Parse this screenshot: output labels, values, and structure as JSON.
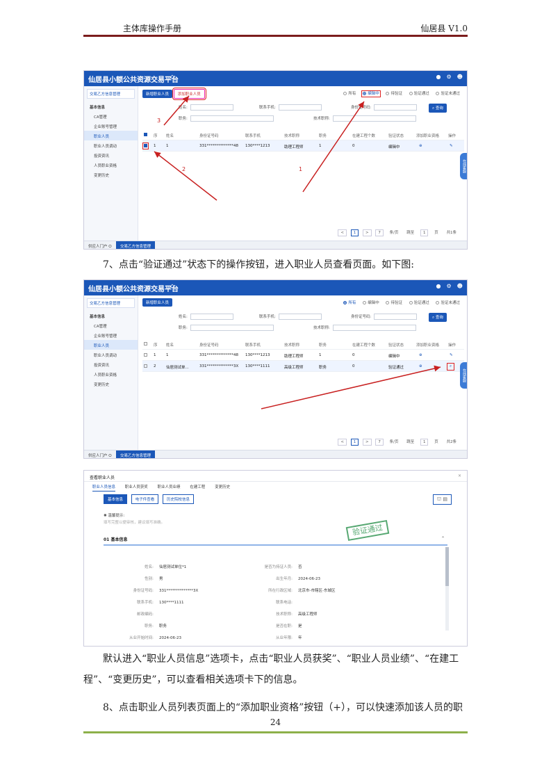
{
  "header": {
    "left": "主体库操作手册",
    "right": "仙居县   V1.0"
  },
  "app": {
    "title": "仙居县小额公共资源交易平台",
    "home_icon": "home-icon"
  },
  "shot1": {
    "sidebar_group": "交易乙方信息管理",
    "sidebar_items": [
      "基本信息",
      "CA管理",
      "企业账号管理",
      "职业人员",
      "职业人员调动",
      "投资资讯",
      "人员职业资格",
      "变更历史"
    ],
    "add_button": "新增职业人员",
    "add_qual_button": "添加职业人员",
    "radios": [
      "所有",
      "编辑中",
      "待验证",
      "验证通过",
      "验证未通过"
    ],
    "fields": {
      "name": "姓名:",
      "phone": "联系手机:",
      "id": "身份证号码:",
      "title": "职务:",
      "skill": "技术职称:"
    },
    "search": "查询",
    "columns": [
      "序",
      "姓名",
      "身份证号码",
      "联系手机",
      "技术职称",
      "职务",
      "在建工程个数",
      "验证状态",
      "添加职业资格",
      "操作"
    ],
    "row": [
      "1",
      "1",
      "331**************48",
      "130****1213",
      "助理工程师",
      "1",
      "0",
      "编辑中"
    ],
    "annot": [
      "1",
      "2",
      "3"
    ],
    "pager": {
      "page": "1",
      "next": ">",
      "prev": "<",
      "size": "7",
      "per": "条/页",
      "go": "跳至",
      "p": "页",
      "total": "共1条",
      "num": "1"
    },
    "bottom": [
      "供应人门户 ⭘",
      "交易乙方信息管理"
    ],
    "sidetab": "在线客服"
  },
  "p7": "7、点击“验证通过”状态下的操作按钮，进入职业人员查看页面。如下图:",
  "shot2": {
    "sidebar_group": "交易乙方信息管理",
    "sidebar_items": [
      "基本信息",
      "CA管理",
      "企业账号管理",
      "职业人员",
      "职业人员调动",
      "投资资讯",
      "人员职业资格",
      "变更历史"
    ],
    "add_button": "新增职业人员",
    "radios": [
      "所有",
      "编辑中",
      "待验证",
      "验证通过",
      "验证未通过"
    ],
    "fields": {
      "name": "姓名:",
      "phone": "联系手机:",
      "id": "身份证号码:",
      "title": "职务:",
      "skill": "技术职称:"
    },
    "search": "查询",
    "columns": [
      "序",
      "姓名",
      "身份证号码",
      "联系手机",
      "技术职称",
      "职务",
      "在建工程个数",
      "验证状态",
      "添加职业资格",
      "操作"
    ],
    "rows": [
      [
        "1",
        "1",
        "331**************48",
        "130****1213",
        "助理工程师",
        "1",
        "0",
        "编辑中"
      ],
      [
        "2",
        "仙居测试单...",
        "331**************3X",
        "130****1111",
        "高级工程师",
        "职务",
        "0",
        "验证通过"
      ]
    ],
    "pager": {
      "page": "1",
      "next": ">",
      "prev": "<",
      "size": "7",
      "per": "条/页",
      "go": "跳至",
      "p": "页",
      "total": "共2条",
      "num": "1"
    },
    "bottom": [
      "供应人门户 ⭘",
      "交易乙方信息管理"
    ],
    "sidetab": "在线客服"
  },
  "shot3": {
    "title": "查看职业人员",
    "close": "×",
    "tabs": [
      "职业人员信息",
      "职业人员获奖",
      "职业人员业绩",
      "在建工程",
      "变更历史"
    ],
    "buttons": [
      "基本信息",
      "电子件查看",
      "历史院校信息"
    ],
    "tip_title": "温馨提示:",
    "tip_sub": "填写完整以便审核，建议填写准确。",
    "section": "01  基本信息",
    "stamp": "验证通过",
    "left": [
      {
        "k": "姓名:",
        "v": "仙居测试单位*1"
      },
      {
        "k": "性别:",
        "v": "男"
      },
      {
        "k": "身份证号码:",
        "v": "331**************3X"
      },
      {
        "k": "联系手机:",
        "v": "130****1111"
      },
      {
        "k": "邮政编码:",
        "v": ""
      },
      {
        "k": "职务:",
        "v": "职务"
      },
      {
        "k": "从业开始时间:",
        "v": "2024-06-23"
      }
    ],
    "right": [
      {
        "k": "是否为持证人员:",
        "v": "否"
      },
      {
        "k": "出生年月:",
        "v": "2024-06-23"
      },
      {
        "k": "所在行政区域:",
        "v": "北京市-市辖区-东城区"
      },
      {
        "k": "联系电话:",
        "v": ""
      },
      {
        "k": "技术职称:",
        "v": "高级工程师"
      },
      {
        "k": "是否在职:",
        "v": "是"
      },
      {
        "k": "从业年限:",
        "v": "年"
      }
    ]
  },
  "pdef": "默认进入“职业人员信息”选项卡，点击“职业人员获奖”、“职业人员业绩”、“在建工程”、“变更历史”，可以查看相关选项卡下的信息。",
  "p8": "8、点击职业人员列表页面上的“添加职业资格”按钮（+），可以快速添加该人员的职",
  "page_number": "24",
  "colors": {
    "brand": "#1b57b8",
    "header_rule": "#7b1c1c",
    "footer_rule": "#8db04a",
    "stamp": "#3a9a5a",
    "annotation": "#d22222"
  }
}
